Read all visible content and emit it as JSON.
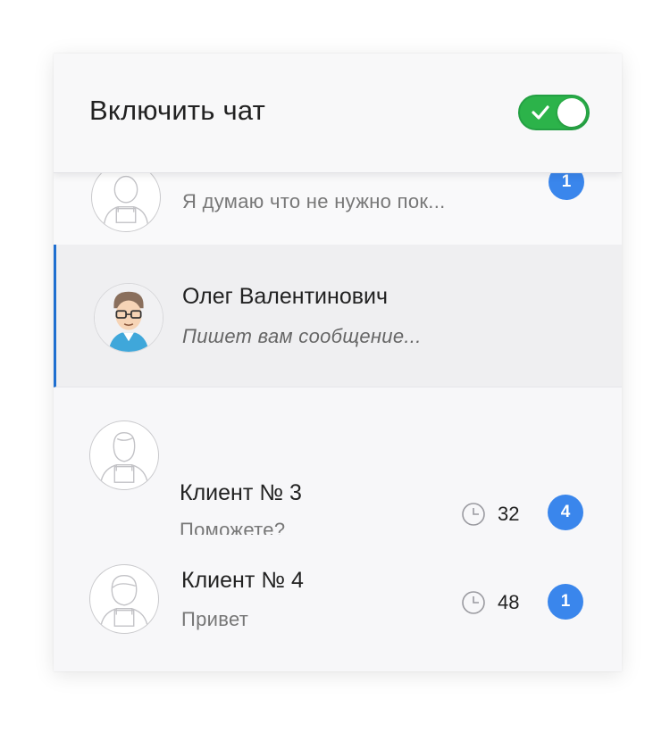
{
  "header": {
    "title": "Включить чат",
    "toggle_on": true,
    "toggle_color": "#2cb34a"
  },
  "chats": [
    {
      "preview": "Я думаю что не нужно пок...",
      "badge": "1",
      "partial": true
    },
    {
      "name": "Олег Валентинович",
      "preview": "Пишет вам сообщение...",
      "active": true,
      "accent": "#1f6fd0"
    },
    {
      "name": "Клиент № 3",
      "preview": "Поможете?",
      "wait_time": "32",
      "badge": "4"
    },
    {
      "name": "Клиент № 4",
      "preview": "Привет",
      "wait_time": "48",
      "badge": "1"
    }
  ],
  "icons": {
    "avatar_placeholder": "user-placeholder-icon",
    "clock": "clock-icon",
    "check": "check-icon"
  },
  "colors": {
    "badge": "#3a86ec",
    "toggle": "#2cb34a"
  }
}
